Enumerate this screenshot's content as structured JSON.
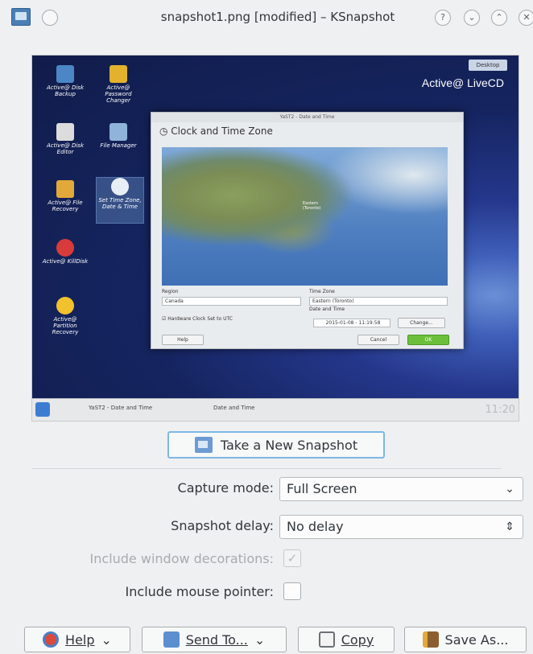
{
  "window": {
    "title": "snapshot1.png [modified] – KSnapshot",
    "help_glyph": "?",
    "minimize_glyph": "⌄",
    "maximize_glyph": "⌃",
    "close_glyph": "✕"
  },
  "preview": {
    "desktop_badge": "Desktop",
    "brand": "Active@ LiveCD",
    "icons": [
      {
        "label": "Active@ Disk Backup"
      },
      {
        "label": "Active@ Password Changer"
      },
      {
        "label": "Active@ Disk Editor"
      },
      {
        "label": "File Manager"
      },
      {
        "label": "Active@ File Recovery"
      },
      {
        "label": "Set Time Zone, Date & Time"
      },
      {
        "label": "Active@ KillDisk"
      },
      {
        "label": "Active@ Partition Recovery"
      }
    ],
    "yast": {
      "window_title": "YaST2 - Date and Time",
      "heading": "Clock and Time Zone",
      "map_label": "Eastern (Toronto)",
      "region_label": "Region",
      "region_value": "Canada",
      "timezone_label": "Time Zone",
      "timezone_value": "Eastern (Toronto)",
      "datetime_label": "Date and Time",
      "datetime_value": "2015-01-08 - 11:19:58",
      "utc_label": "Hardware Clock Set to UTC",
      "change_btn": "Change...",
      "help_btn": "Help",
      "cancel_btn": "Cancel",
      "ok_btn": "OK"
    },
    "taskbar": {
      "task1": "YaST2 - Date and Time",
      "task2": "Date and Time",
      "clock": "11:20"
    }
  },
  "actions": {
    "new_snapshot": "Take a New Snapshot"
  },
  "form": {
    "capture_mode_label": "Capture mode:",
    "capture_mode_value": "Full Screen",
    "delay_label": "Snapshot delay:",
    "delay_value": "No delay",
    "window_decorations_label": "Include window decorations:",
    "mouse_pointer_label": "Include mouse pointer:"
  },
  "buttons": {
    "help": "Help",
    "send_to": "Send To...",
    "copy": "Copy",
    "save_as": "Save As..."
  },
  "colors": {
    "accent": "#7fb7e3",
    "background": "#eff0f1",
    "ok_green": "#6cbf3a"
  }
}
